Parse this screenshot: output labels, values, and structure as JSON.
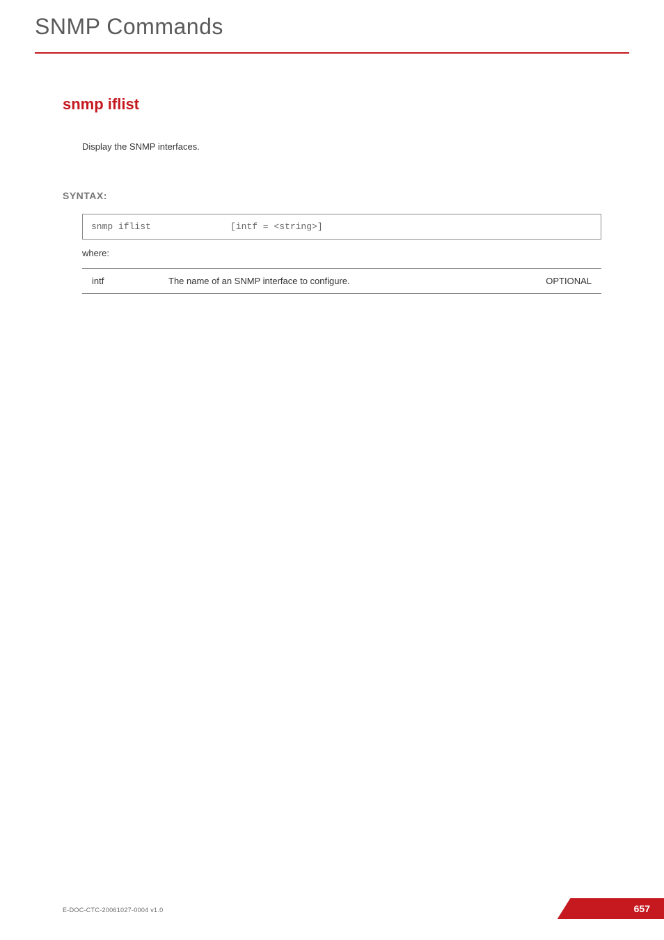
{
  "header": {
    "title": "SNMP Commands"
  },
  "command": {
    "title": "snmp iflist",
    "description": "Display the SNMP interfaces."
  },
  "syntax": {
    "label": "SYNTAX:",
    "command": "snmp iflist",
    "args": "[intf = <string>]",
    "where_label": "where:"
  },
  "params": [
    {
      "name": "intf",
      "description": "The name of an  SNMP interface to configure.",
      "required": "OPTIONAL"
    }
  ],
  "footer": {
    "doc_id": "E-DOC-CTC-20061027-0004 v1.0",
    "page_number": "657"
  }
}
